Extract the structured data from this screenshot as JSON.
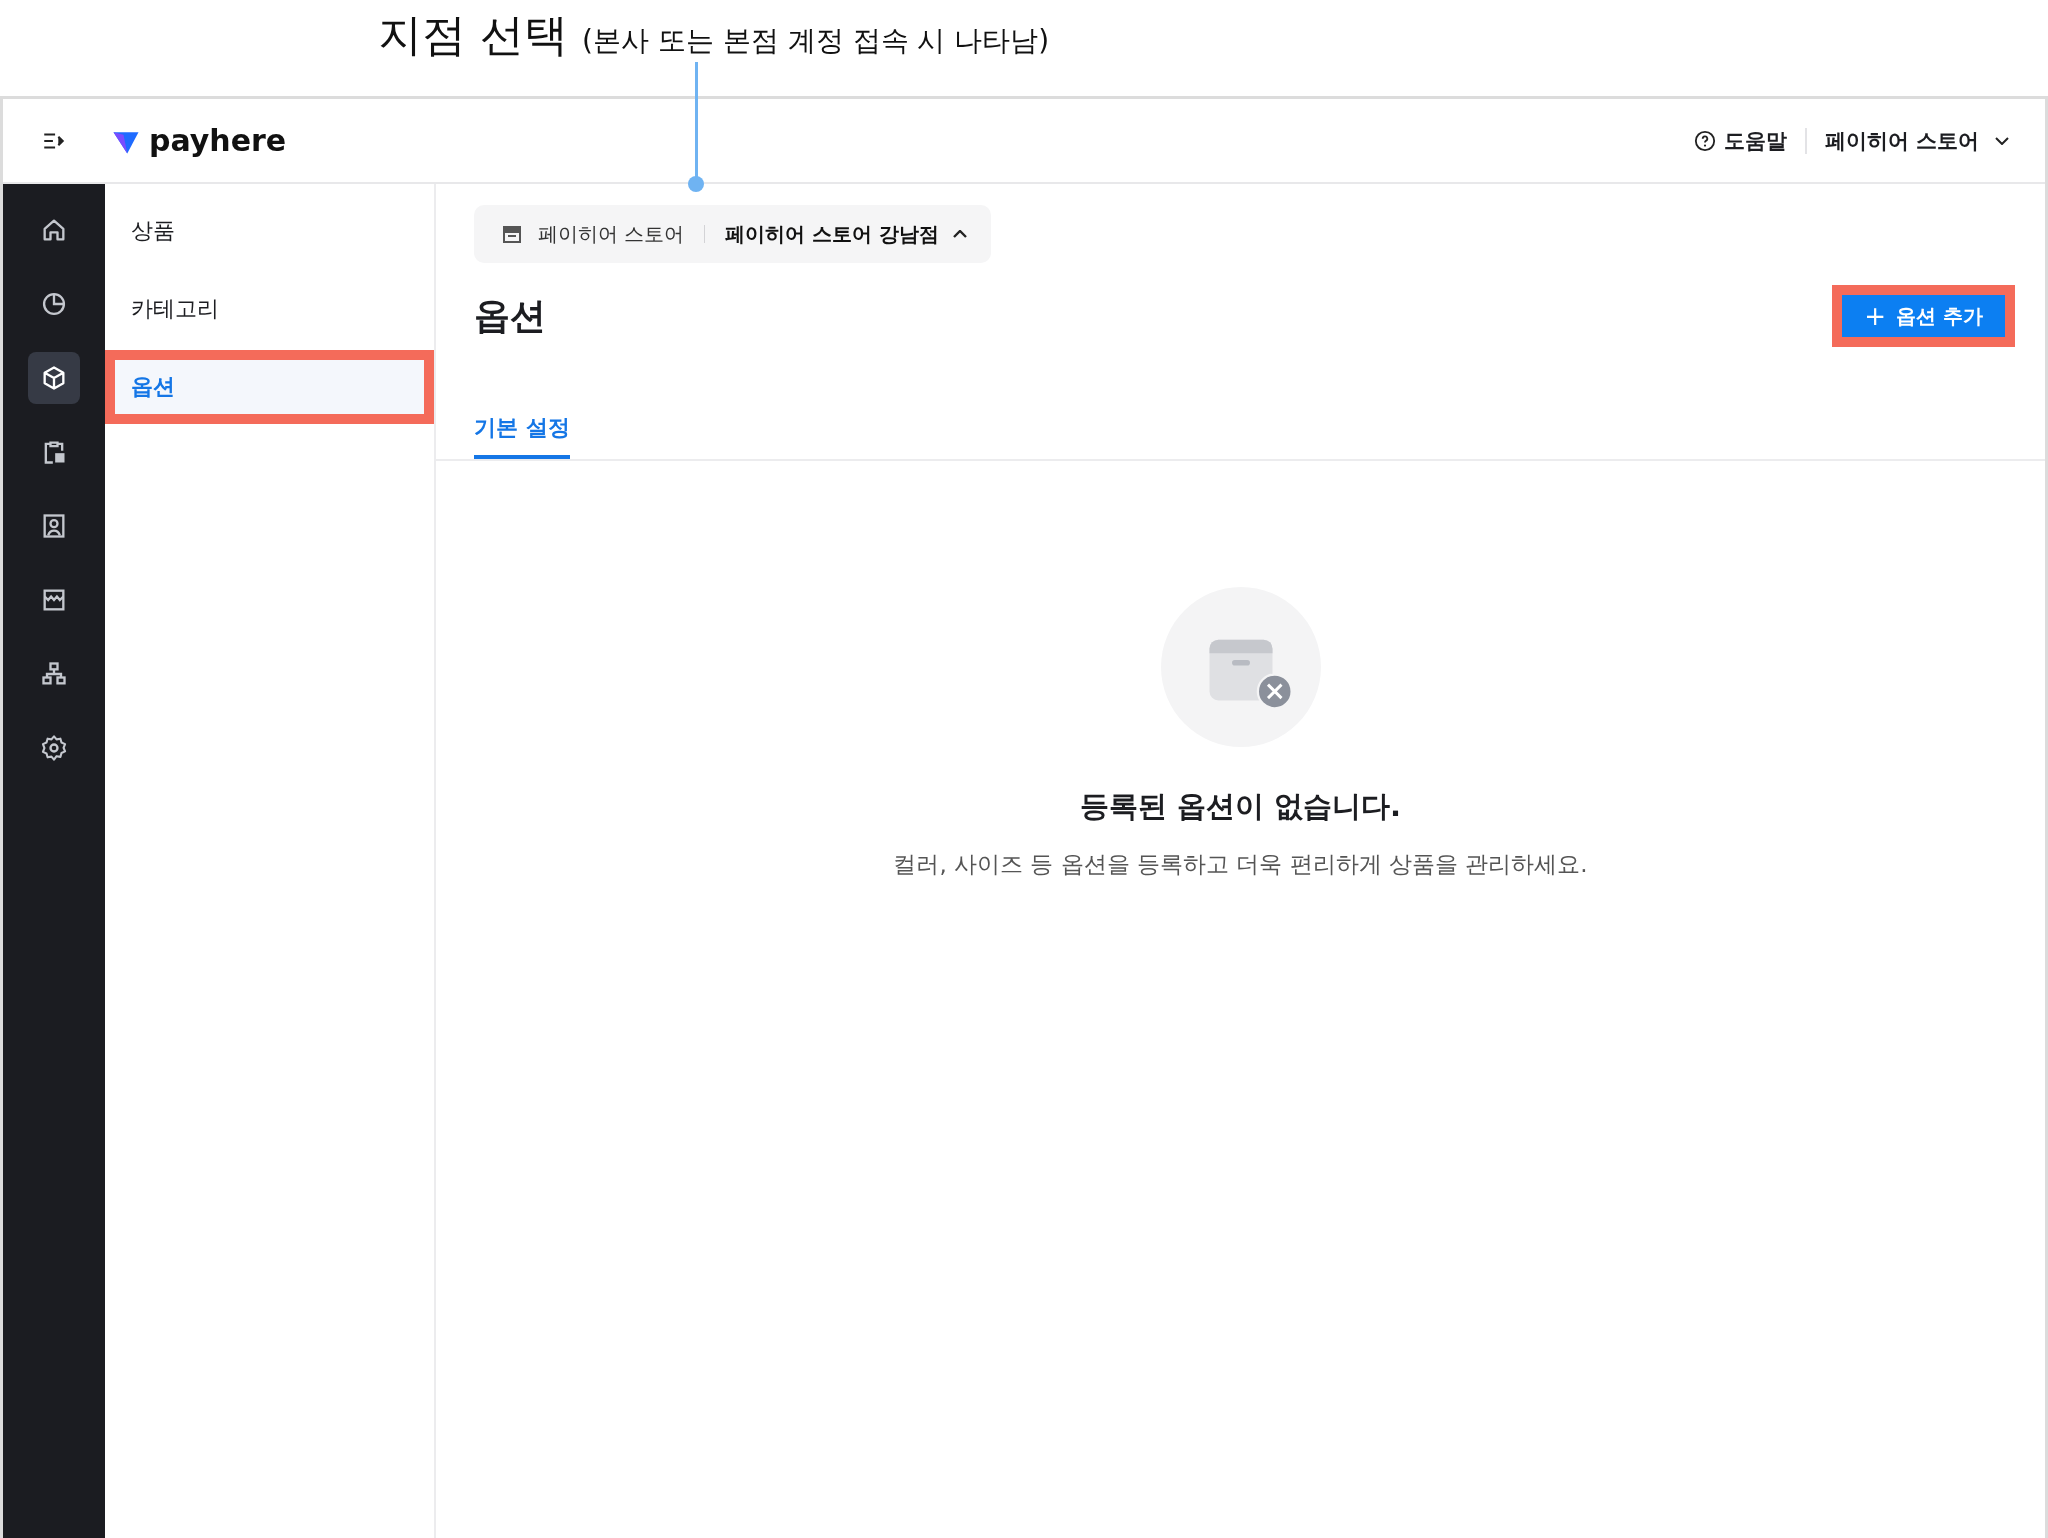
{
  "callout": {
    "title": "지점 선택",
    "note": "(본사 또는 본점 계정 접속 시 나타남)"
  },
  "header": {
    "logo": "payhere",
    "help": "도움말",
    "account": "페이히어 스토어"
  },
  "rail": [
    {
      "kind": "home",
      "selected": false
    },
    {
      "kind": "chart",
      "selected": false
    },
    {
      "kind": "box",
      "selected": true
    },
    {
      "kind": "clipboard",
      "selected": false
    },
    {
      "kind": "contact",
      "selected": false
    },
    {
      "kind": "store",
      "selected": false
    },
    {
      "kind": "hierarchy",
      "selected": false
    },
    {
      "kind": "settings",
      "selected": false
    }
  ],
  "submenu": [
    {
      "label": "상품",
      "selected": false,
      "highlighted": false
    },
    {
      "label": "카테고리",
      "selected": false,
      "highlighted": false
    },
    {
      "label": "옵션",
      "selected": true,
      "highlighted": true
    }
  ],
  "branch_selector": {
    "store": "페이히어 스토어",
    "branch": "페이히어 스토어 강남점",
    "expanded": true
  },
  "page": {
    "title": "옵션",
    "add_button": {
      "icon": "+",
      "label": "옵션 추가",
      "highlighted": true
    }
  },
  "tabs": [
    {
      "label": "기본 설정",
      "selected": true
    }
  ],
  "empty_state": {
    "title": "등록된 옵션이 없습니다.",
    "description": "컬러, 사이즈 등 옵션을 등록하고 더욱 편리하게 상품을 관리하세요."
  }
}
